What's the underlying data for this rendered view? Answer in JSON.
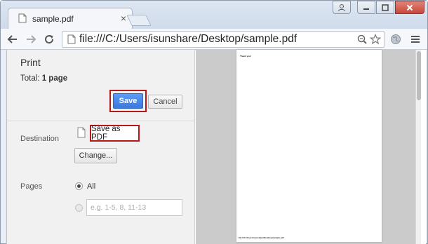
{
  "tab": {
    "title": "sample.pdf",
    "close_symbol": "×"
  },
  "address_bar": {
    "url": "file:///C:/Users/isunshare/Desktop/sample.pdf"
  },
  "print_panel": {
    "heading": "Print",
    "total_label": "Total:",
    "total_value": "1 page",
    "save_label": "Save",
    "cancel_label": "Cancel",
    "destination_label": "Destination",
    "destination_value": "Save as PDF",
    "change_label": "Change...",
    "pages_label": "Pages",
    "pages_all_label": "All",
    "pages_custom_placeholder": "e.g. 1-5, 8, 11-13"
  },
  "preview": {
    "page_text": "Thank you!",
    "page_footer": "file:///C:/Users/isunshare/Desktop/sample.pdf"
  },
  "colors": {
    "highlight_box": "#b21a1a",
    "save_button": "#3a78de",
    "preview_background": "#cbcbcb"
  },
  "icons": [
    "document-icon",
    "close-icon",
    "user-icon",
    "minimize-icon",
    "maximize-icon",
    "close-window-icon",
    "back-icon",
    "forward-icon",
    "reload-icon",
    "page-icon",
    "zoom-icon",
    "star-icon",
    "globe-icon",
    "menu-icon"
  ]
}
